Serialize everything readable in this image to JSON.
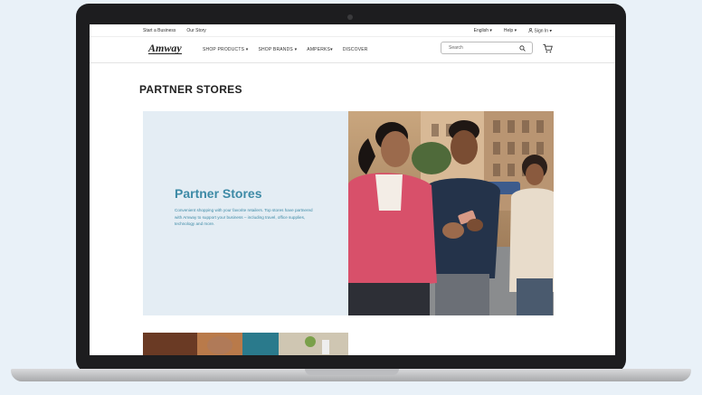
{
  "utility_bar": {
    "links": [
      "Start a Business",
      "Our Story"
    ],
    "language": "English",
    "help": "Help",
    "sign_in": "Sign In"
  },
  "nav": {
    "logo": "Amway",
    "items": [
      "SHOP PRODUCTS",
      "SHOP BRANDS",
      "AMPERKS",
      "DISCOVER"
    ],
    "search_placeholder": "Search"
  },
  "page": {
    "title": "PARTNER STORES"
  },
  "hero": {
    "heading": "Partner Stores",
    "description": "Convenient shopping with your favorite retailers. Top stores have partnered with Amway to support your business – including travel, office supplies, technology and more."
  },
  "colors": {
    "accent": "#3d8aa6",
    "panel": "#e4edf4",
    "background": "#e9f1f8"
  }
}
